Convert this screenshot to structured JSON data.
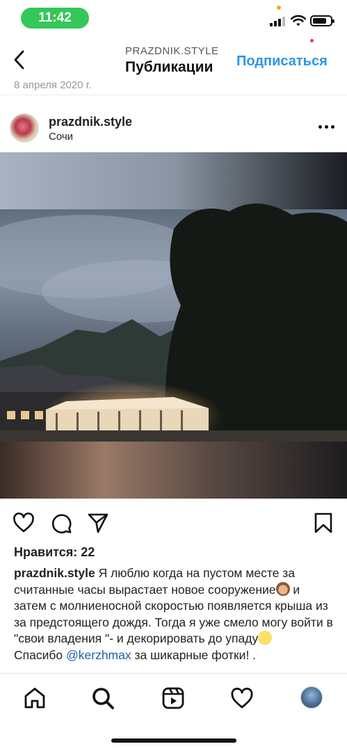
{
  "status_bar": {
    "time": "11:42",
    "battery_level": 0.8,
    "time_pill_color": "#34c759"
  },
  "header": {
    "subtitle": "PRAZDNIK.STYLE",
    "title": "Публикации",
    "follow_label": "Подписаться",
    "back_icon": "chevron-left-icon",
    "accent_color": "#2b96e8"
  },
  "previous_post": {
    "date": "8 апреля 2020 г."
  },
  "post": {
    "username": "prazdnik.style",
    "location": "Сочи",
    "more_icon": "ellipsis-icon",
    "photo_description_icon": "photo",
    "actions": {
      "like_icon": "heart-icon",
      "comment_icon": "comment-icon",
      "share_icon": "send-icon",
      "save_icon": "bookmark-icon"
    },
    "likes_text": "Нравится: 22",
    "caption": {
      "username": "prazdnik.style",
      "line1": " Я люблю когда на пустом месте за считанные часы вырастает новое сооружение",
      "line2": " и затем с молниеносной скоростью появляется крыша из за предстоящего дождя. Тогда я уже смело могу войти в \"свои владения \"- и декорировать до упаду",
      "thanks_prefix": "Спасибо ",
      "mention": "@kerzhmax",
      "thanks_suffix": " за шикарные фотки! ."
    }
  },
  "tab_bar": {
    "items": [
      {
        "name": "home-icon"
      },
      {
        "name": "search-icon"
      },
      {
        "name": "reels-icon"
      },
      {
        "name": "activity-heart-icon"
      },
      {
        "name": "profile-avatar"
      }
    ],
    "notification_dot_color": "#e8384f"
  }
}
